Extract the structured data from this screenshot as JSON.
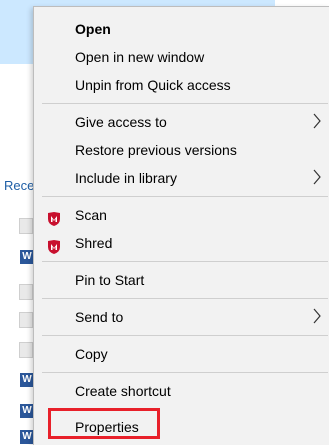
{
  "background": {
    "top_text": "",
    "recent_label": "Rece"
  },
  "menu": {
    "items": [
      {
        "label": "Open",
        "bold": true
      },
      {
        "label": "Open in new window"
      },
      {
        "label": "Unpin from Quick access"
      },
      {
        "label": "Give access to",
        "submenu": true
      },
      {
        "label": "Restore previous versions"
      },
      {
        "label": "Include in library",
        "submenu": true
      },
      {
        "label": "Scan",
        "icon": "mcafee-icon"
      },
      {
        "label": "Shred",
        "icon": "mcafee-icon"
      },
      {
        "label": "Pin to Start"
      },
      {
        "label": "Send to",
        "submenu": true
      },
      {
        "label": "Copy"
      },
      {
        "label": "Create shortcut"
      },
      {
        "label": "Properties"
      }
    ]
  },
  "icons": {
    "submenu": "chevron-right-icon",
    "mcafee": "mcafee-shield-icon"
  },
  "colors": {
    "selection_bg": "#cce8ff",
    "menu_bg": "#f2f2f2",
    "highlight_border": "#e8202a",
    "mcafee_red": "#c8102e",
    "word_blue": "#2b579a"
  },
  "word_badge": "W"
}
